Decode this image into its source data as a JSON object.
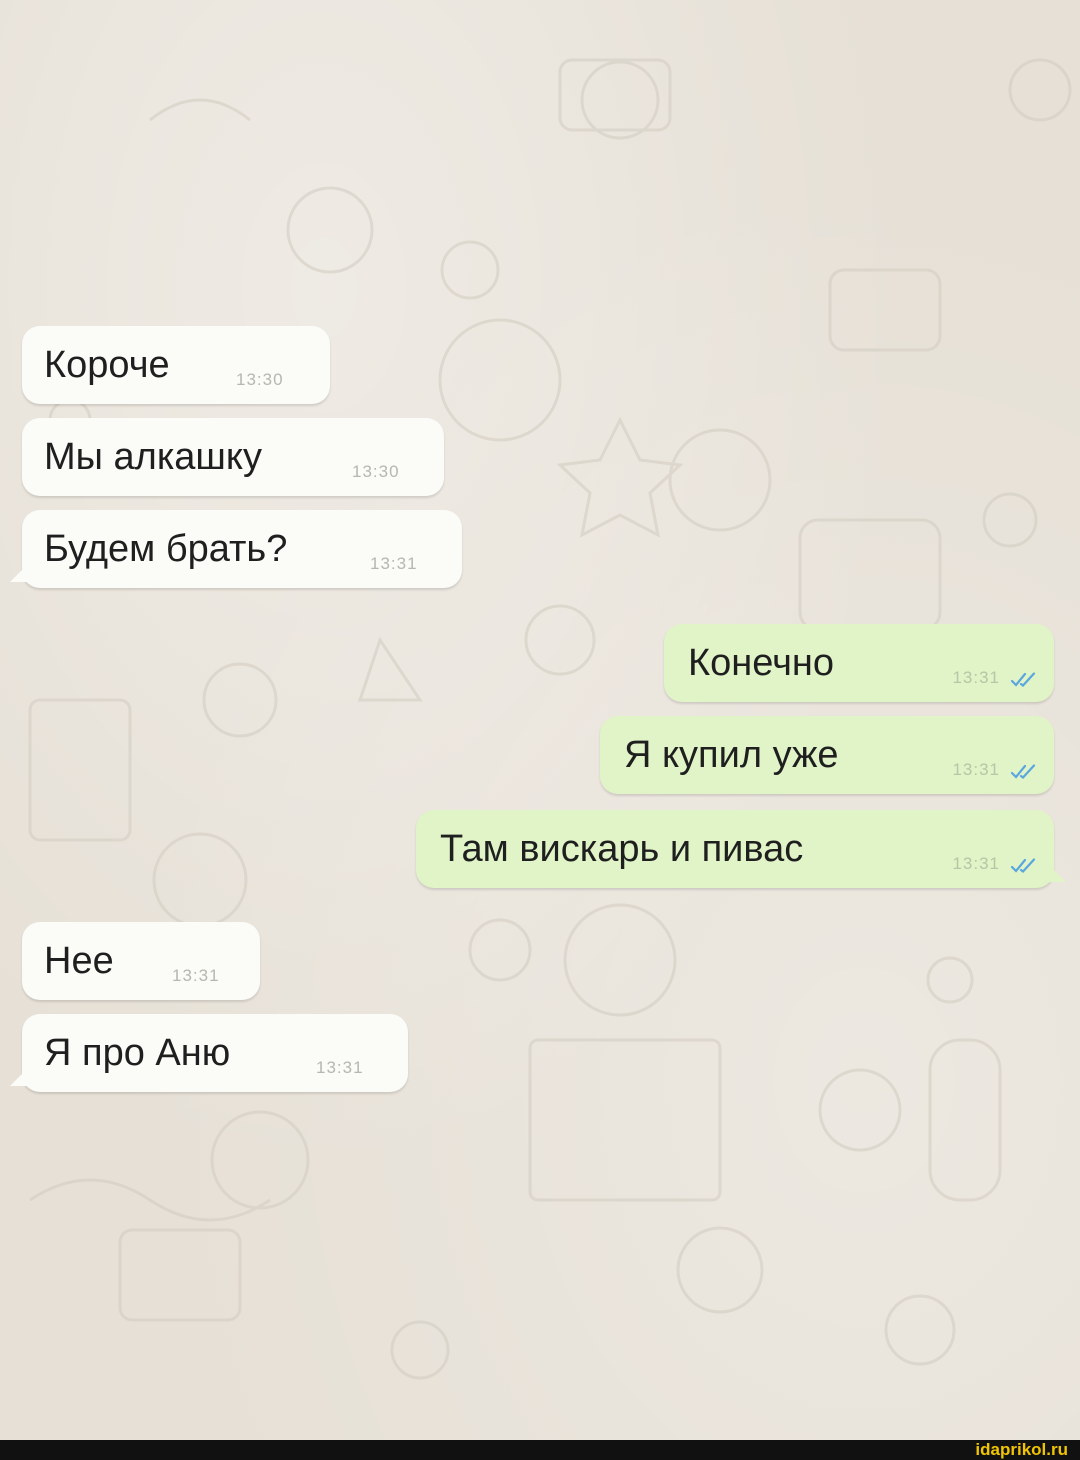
{
  "chat": {
    "messages": [
      {
        "direction": "incoming",
        "text": "Короче",
        "time": "13:30"
      },
      {
        "direction": "incoming",
        "text": "Мы алкашку",
        "time": "13:30"
      },
      {
        "direction": "incoming",
        "text": "Будем брать?",
        "time": "13:31"
      },
      {
        "direction": "outgoing",
        "text": "Конечно",
        "time": "13:31",
        "status_icon": "double-check-icon"
      },
      {
        "direction": "outgoing",
        "text": "Я купил уже",
        "time": "13:31",
        "status_icon": "double-check-icon"
      },
      {
        "direction": "outgoing",
        "text": "Там вискарь и пивас",
        "time": "13:31",
        "status_icon": "double-check-icon"
      },
      {
        "direction": "incoming",
        "text": "Нее",
        "time": "13:31"
      },
      {
        "direction": "incoming",
        "text": "Я про Аню",
        "time": "13:31"
      }
    ]
  },
  "colors": {
    "incoming_bubble": "#fbfbf8",
    "outgoing_bubble": "#e0f4c7",
    "read_ticks": "#5aa7e0",
    "watermark_text": "#f0c400"
  },
  "footer": {
    "watermark": "idaprikol.ru"
  }
}
